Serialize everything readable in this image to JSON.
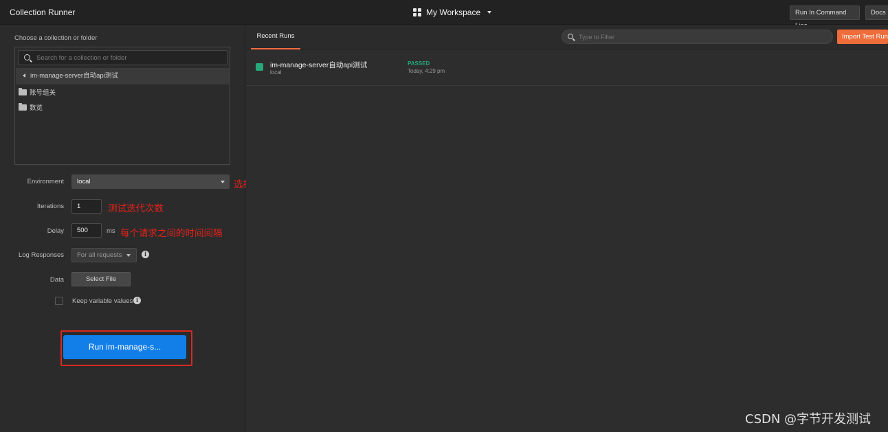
{
  "app": {
    "title": "Collection Runner",
    "workspace": "My Workspace"
  },
  "topbar": {
    "run_cli": "Run In Command Line",
    "docs": "Docs"
  },
  "left": {
    "choose_label": "Choose a collection or folder",
    "search_placeholder": "Search for a collection or folder",
    "breadcrumb": "im-manage-server自动api测试",
    "folders": [
      {
        "name": "账号组关"
      },
      {
        "name": "数览"
      }
    ]
  },
  "form": {
    "environment_label": "Environment",
    "environment_value": "local",
    "iterations_label": "Iterations",
    "iterations_value": "1",
    "delay_label": "Delay",
    "delay_value": "500",
    "delay_unit": "ms",
    "log_label": "Log Responses",
    "log_value": "For all requests",
    "data_label": "Data",
    "select_file": "Select File",
    "keep_vars": "Keep variable values",
    "run_button": "Run im-manage-s..."
  },
  "annotations": {
    "environment": "选择环境变量",
    "iterations": "测试迭代次数",
    "delay": "每个请求之间的时间间隔"
  },
  "right": {
    "tab": "Recent Runs",
    "filter_placeholder": "Type to Filter",
    "import_button": "Import Test Run",
    "runs": [
      {
        "name": "im-manage-server自动api测试",
        "env": "local",
        "status": "PASSED",
        "time": "Today, 4:29 pm"
      }
    ]
  },
  "watermark": "CSDN @字节开发测试",
  "colors": {
    "accent_run": "#127ee8",
    "import": "#ef6c3b",
    "passed": "#27a97b",
    "annotation": "#e5221a"
  }
}
